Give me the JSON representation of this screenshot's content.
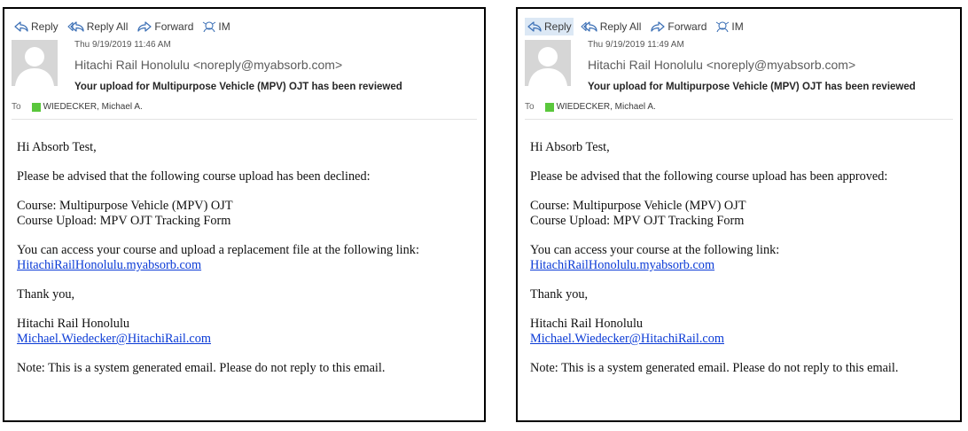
{
  "actions": {
    "reply": "Reply",
    "reply_all": "Reply All",
    "forward": "Forward",
    "im": "IM"
  },
  "emails": [
    {
      "date": "Thu 9/19/2019 11:46 AM",
      "from": "Hitachi Rail Honolulu <noreply@myabsorb.com>",
      "subject": "Your upload for Multipurpose Vehicle (MPV) OJT has been reviewed",
      "to_label": "To",
      "to_name": "WIEDECKER, Michael A.",
      "greeting": "Hi Absorb Test,",
      "advised": "Please be advised that the following course upload has been declined:",
      "course": "Course: Multipurpose Vehicle (MPV) OJT",
      "course_upload": "Course Upload: MPV OJT Tracking Form",
      "access": "You can access your course and upload a replacement file at the following link:",
      "link": "HitachiRailHonolulu.myabsorb.com",
      "thanks": "Thank you,",
      "signature": "Hitachi Rail Honolulu",
      "email_link": "Michael.Wiedecker@HitachiRail.com",
      "note": "Note: This is a system generated email. Please do not reply to this email."
    },
    {
      "date": "Thu 9/19/2019 11:49 AM",
      "from": "Hitachi Rail Honolulu <noreply@myabsorb.com>",
      "subject": "Your upload for Multipurpose Vehicle (MPV) OJT has been reviewed",
      "to_label": "To",
      "to_name": "WIEDECKER, Michael A.",
      "greeting": "Hi Absorb Test,",
      "advised": "Please be advised that the following course upload has been approved:",
      "course": "Course: Multipurpose Vehicle (MPV) OJT",
      "course_upload": "Course Upload: MPV OJT Tracking Form",
      "access": "You can access your course at the following link:",
      "link": "HitachiRailHonolulu.myabsorb.com",
      "thanks": "Thank you,",
      "signature": "Hitachi Rail Honolulu",
      "email_link": "Michael.Wiedecker@HitachiRail.com",
      "note": "Note: This is a system generated email. Please do not reply to this email."
    }
  ],
  "colors": {
    "presence": "#5ac73c",
    "link": "#0b3bd6",
    "highlight": "#dce8f5"
  }
}
